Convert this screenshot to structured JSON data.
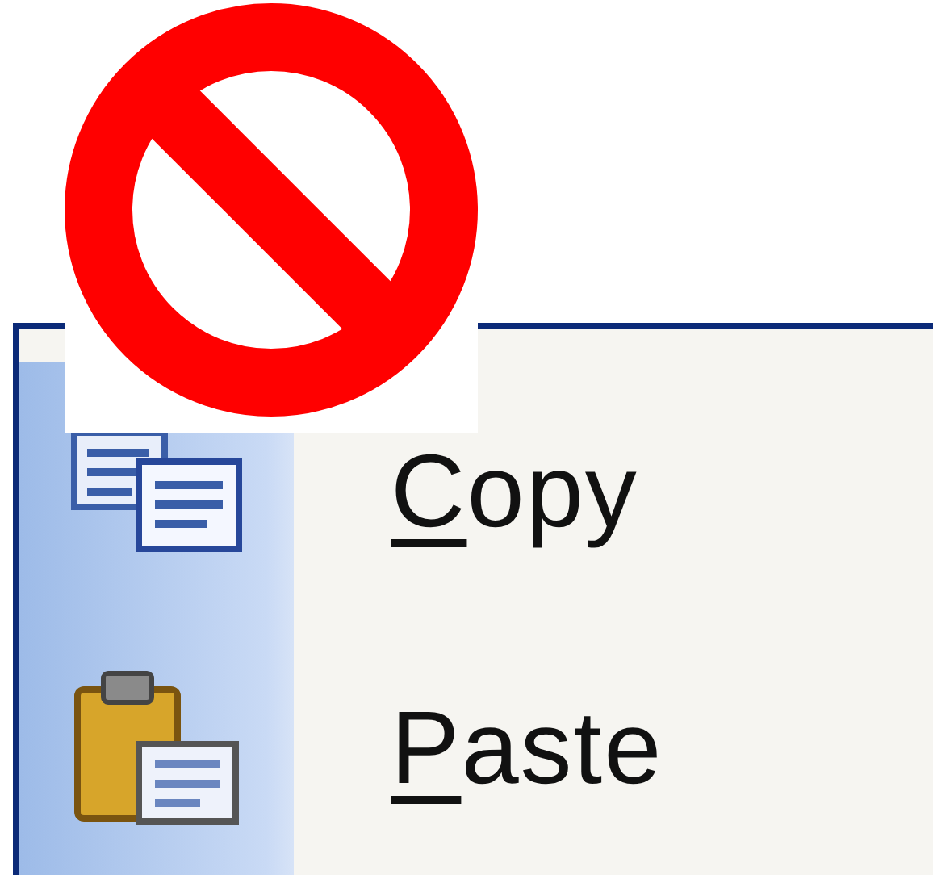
{
  "menu": {
    "items": [
      {
        "kind": "copy",
        "mnemonic": "C",
        "rest": "opy"
      },
      {
        "kind": "paste",
        "mnemonic": "P",
        "rest": "aste"
      }
    ]
  },
  "overlay": {
    "kind": "prohibited"
  }
}
